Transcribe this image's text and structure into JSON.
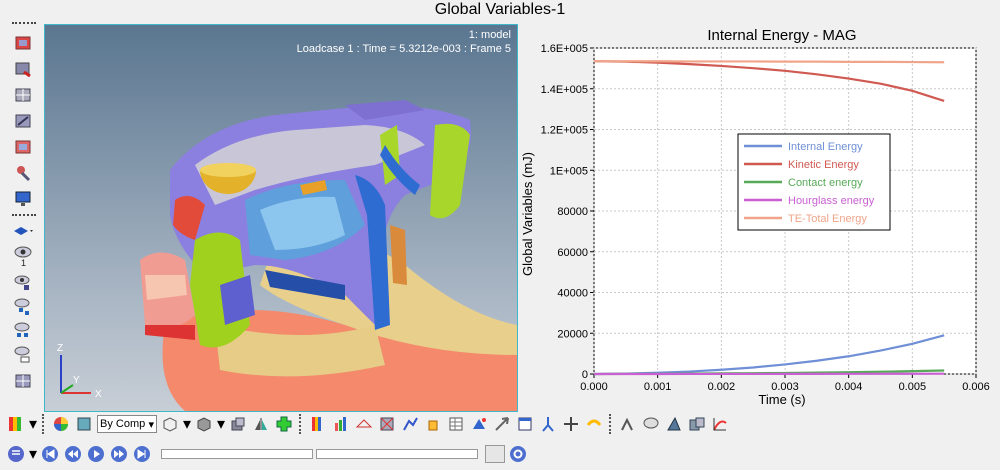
{
  "window": {
    "title": "Global Variables-1"
  },
  "viewport": {
    "model_label": "1: model",
    "loadcase_label": "Loadcase 1 : Time = 5.3212e-003 : Frame 5",
    "axes": {
      "z": "Z",
      "y": "Y",
      "x": "X"
    }
  },
  "left_toolbar": {
    "icons": [
      "view-icon",
      "display-icon",
      "contour-icon",
      "section-icon",
      "measure-icon",
      "monitor-icon",
      "layer-icon",
      "eye-icon",
      "eye-icon",
      "tree-icon",
      "tree-icon",
      "tree-icon",
      "grid-icon"
    ],
    "label_1": "1"
  },
  "bottom_toolbar": {
    "combo_value": "By Comp"
  },
  "chart_data": {
    "type": "line",
    "title": "Internal Energy - MAG",
    "xlabel": "Time (s)",
    "ylabel": "Global Variables (mJ)",
    "xlim": [
      0,
      0.006
    ],
    "ylim": [
      0,
      160000
    ],
    "x_ticks": [
      "0.000",
      "0.001",
      "0.002",
      "0.003",
      "0.004",
      "0.005",
      "0.006"
    ],
    "y_ticks": [
      "0",
      "20000",
      "40000",
      "60000",
      "80000",
      "1E+005",
      "1.2E+005",
      "1.4E+005",
      "1.6E+005"
    ],
    "x": [
      0,
      0.0005,
      0.001,
      0.0015,
      0.002,
      0.0025,
      0.003,
      0.0035,
      0.004,
      0.0045,
      0.005,
      0.0055
    ],
    "series": [
      {
        "name": "Internal Energy",
        "color": "#6f8fd6",
        "values": [
          0,
          200,
          600,
          1200,
          2100,
          3200,
          4700,
          6500,
          8700,
          11500,
          14800,
          19000
        ]
      },
      {
        "name": "Kinetic Energy",
        "color": "#d05a52",
        "values": [
          153500,
          153300,
          152800,
          152100,
          151200,
          150100,
          148800,
          147100,
          145000,
          142500,
          139000,
          134000
        ]
      },
      {
        "name": "Contact energy",
        "color": "#57aa58",
        "values": [
          0,
          50,
          100,
          200,
          300,
          400,
          500,
          700,
          900,
          1100,
          1400,
          1700
        ]
      },
      {
        "name": "Hourglass energy",
        "color": "#c95fd3",
        "values": [
          0,
          0,
          10,
          20,
          30,
          40,
          50,
          60,
          80,
          100,
          120,
          150
        ]
      },
      {
        "name": "TE-Total Energy",
        "color": "#f0a58a",
        "values": [
          153500,
          153500,
          153500,
          153400,
          153400,
          153400,
          153300,
          153300,
          153200,
          153200,
          153100,
          153000
        ]
      }
    ],
    "legend_position": "center-right",
    "grid": true
  }
}
